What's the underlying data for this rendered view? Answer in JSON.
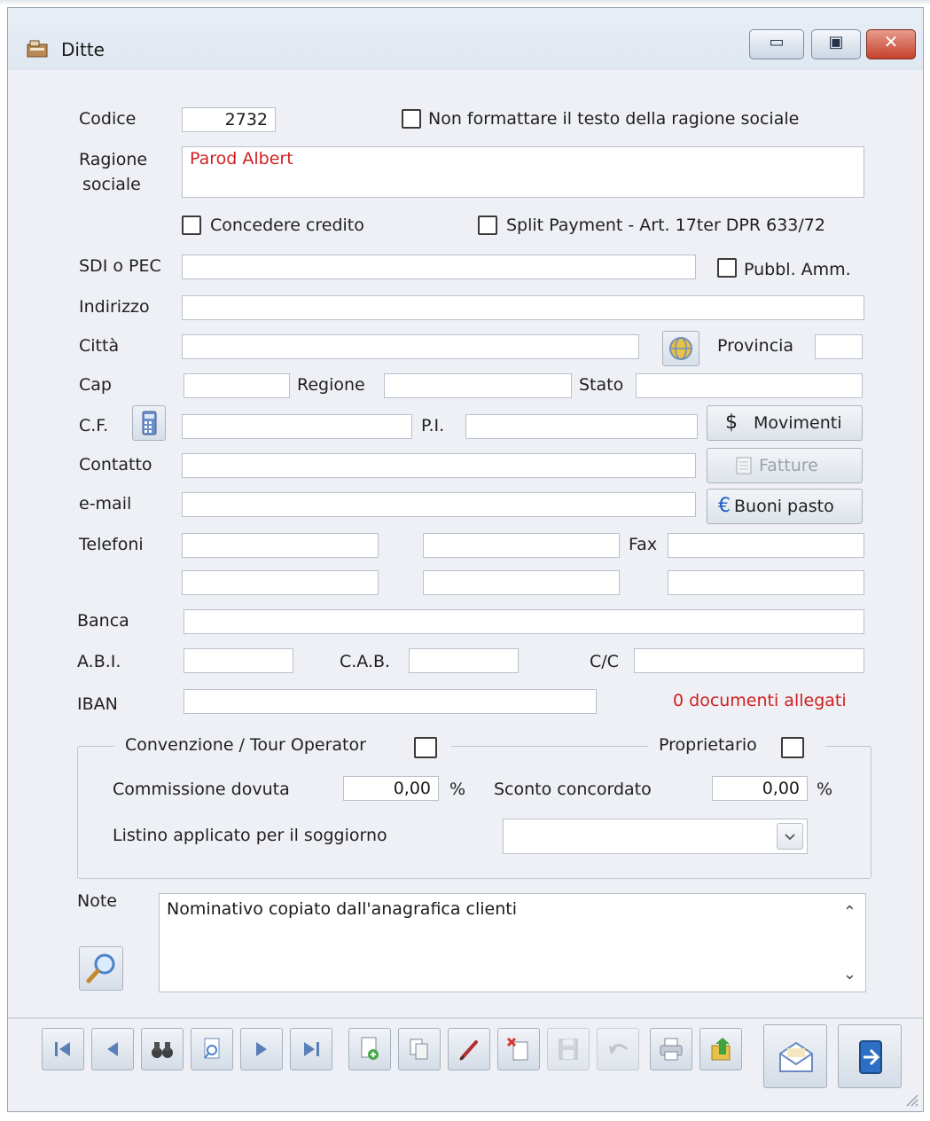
{
  "window": {
    "title": "Ditte"
  },
  "labels": {
    "codice": "Codice",
    "ragione_line1": "Ragione",
    "ragione_line2": "sociale",
    "non_formattare": "Non formattare il testo della ragione sociale",
    "concedere_credito": "Concedere credito",
    "split_payment": "Split Payment - Art. 17ter DPR 633/72",
    "sdi_pec": "SDI o PEC",
    "pubbl_amm": "Pubbl. Amm.",
    "indirizzo": "Indirizzo",
    "citta": "Città",
    "provincia": "Provincia",
    "cap": "Cap",
    "regione": "Regione",
    "stato": "Stato",
    "cf": "C.F.",
    "pi": "P.I.",
    "contatto": "Contatto",
    "email": "e-mail",
    "telefoni": "Telefoni",
    "fax": "Fax",
    "banca": "Banca",
    "abi": "A.B.I.",
    "cab": "C.A.B.",
    "cc": "C/C",
    "iban": "IBAN",
    "documenti": "0 documenti allegati",
    "convenzione": "Convenzione / Tour Operator",
    "proprietario": "Proprietario",
    "commissione": "Commissione dovuta",
    "sconto": "Sconto concordato",
    "percent": "%",
    "listino": "Listino applicato per il soggiorno",
    "note": "Note"
  },
  "fields": {
    "codice": "2732",
    "ragione_sociale": "Parod Albert",
    "commissione": "0,00",
    "sconto": "0,00",
    "note": "Nominativo copiato dall'anagrafica clienti"
  },
  "buttons": {
    "movimenti": "Movimenti",
    "movimenti_symbol": "$",
    "fatture": "Fatture",
    "buoni_pasto": "Buoni pasto",
    "buoni_symbol": "€"
  },
  "colors": {
    "accent_red": "#d02020"
  }
}
